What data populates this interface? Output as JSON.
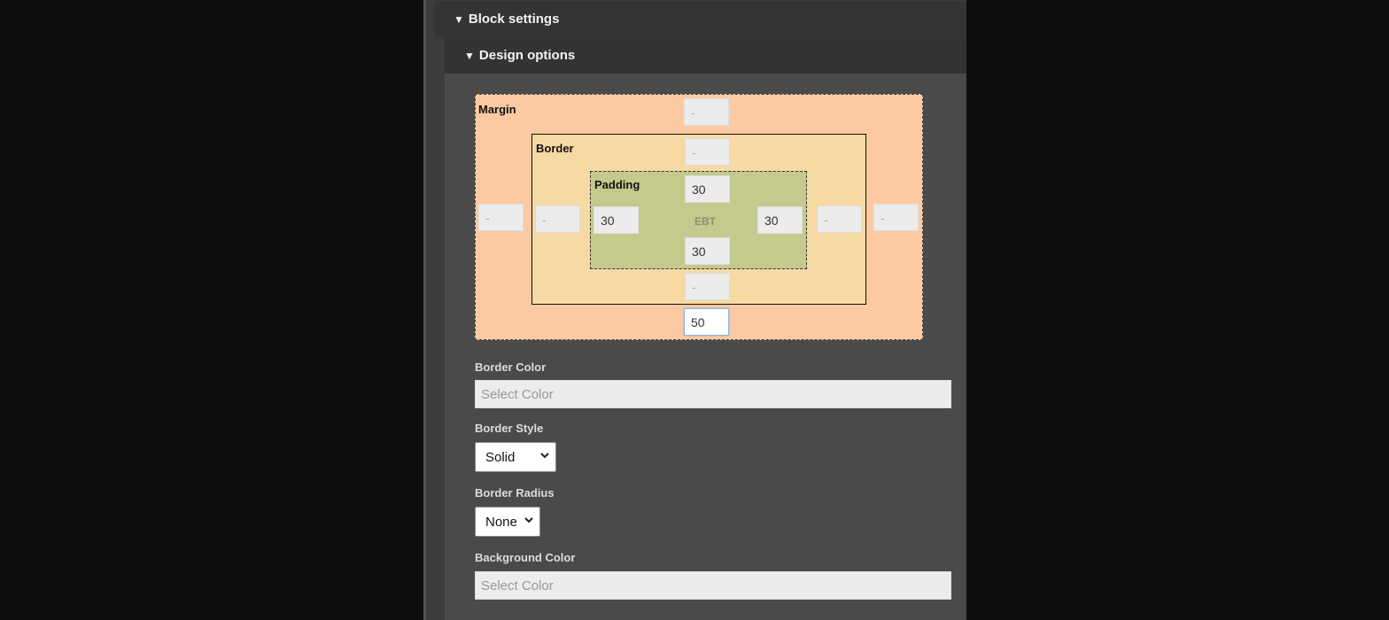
{
  "sections": {
    "block_settings": "Block settings",
    "design_options": "Design options"
  },
  "box_model": {
    "margin_label": "Margin",
    "border_label": "Border",
    "padding_label": "Padding",
    "center_label": "EBT",
    "margin": {
      "top": "",
      "right": "",
      "bottom": "50",
      "left": ""
    },
    "border": {
      "top": "",
      "right": "",
      "bottom": "",
      "left": ""
    },
    "padding": {
      "top": "30",
      "right": "30",
      "bottom": "30",
      "left": "30"
    },
    "empty_placeholder": "-"
  },
  "fields": {
    "border_color_label": "Border Color",
    "border_color_placeholder": "Select Color",
    "border_style_label": "Border Style",
    "border_style_value": "Solid",
    "border_radius_label": "Border Radius",
    "border_radius_value": "None",
    "background_color_label": "Background Color",
    "background_color_placeholder": "Select Color"
  },
  "colors": {
    "margin_fill": "#fbcaa3",
    "border_fill": "#f7d9a4",
    "padding_fill": "#c4c98d",
    "panel_bg": "#494a49"
  },
  "icons": {
    "collapse": "triangle-down-icon",
    "dropdown": "chevron-down-icon"
  }
}
